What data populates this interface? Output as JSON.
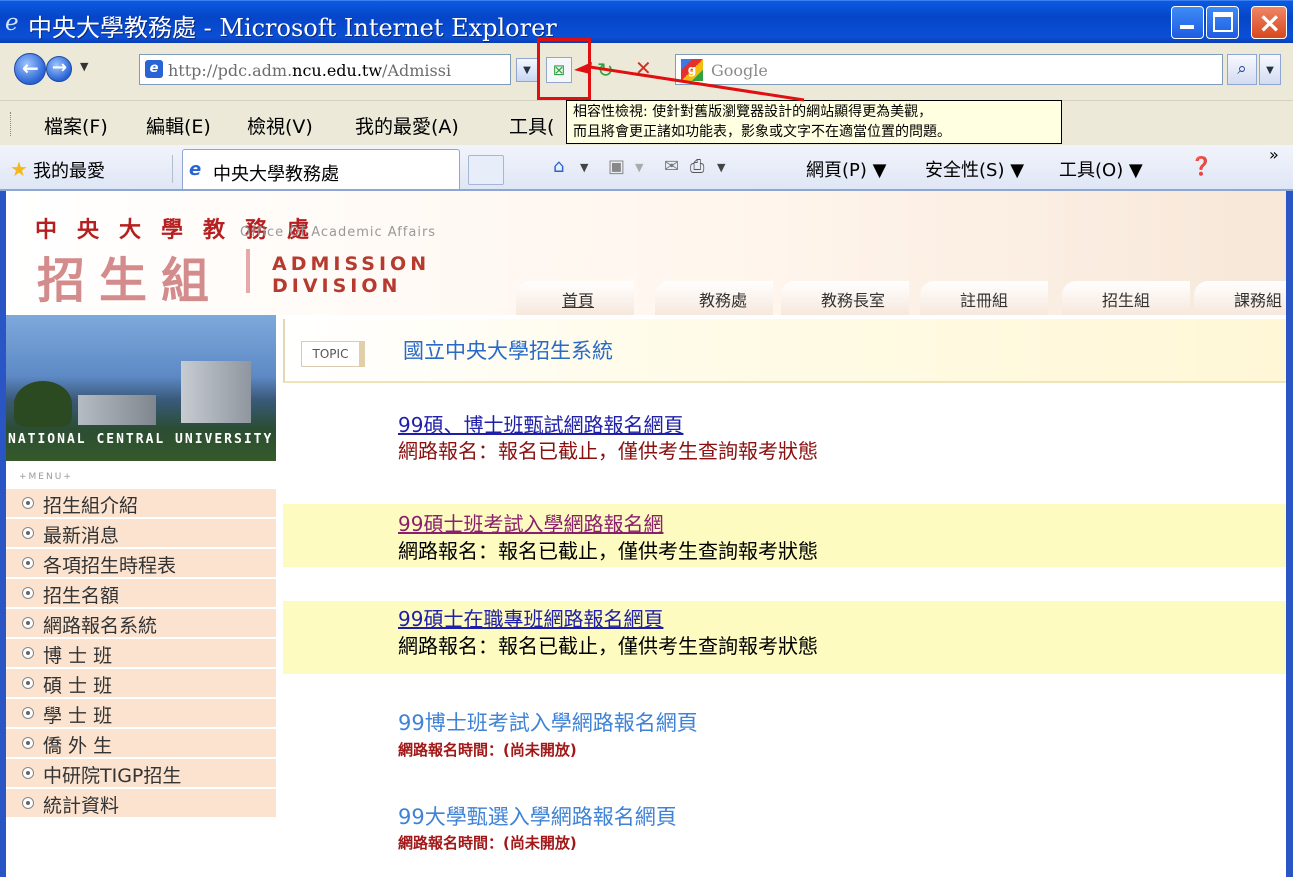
{
  "window": {
    "title": "中央大學教務處 - Microsoft Internet Explorer",
    "ie_icon": "ie-logo-icon",
    "controls": [
      "minimize-icon",
      "maximize-icon",
      "close-icon"
    ]
  },
  "addressbar": {
    "url_prefix": "http://pdc.adm.",
    "url_domain": "ncu.edu.tw",
    "url_suffix": "/Admissi",
    "search_placeholder": "Google",
    "compat_glyph": "⊠",
    "refresh_glyph": "↻",
    "stop_glyph": "✕"
  },
  "menubar": {
    "items": [
      "檔案(F)",
      "編輯(E)",
      "檢視(V)",
      "我的最愛(A)",
      "工具("
    ]
  },
  "tooltip": {
    "line1": "相容性檢視: 使針對舊版瀏覽器設計的網站顯得更為美觀，",
    "line2": "而且將會更正諸如功能表，影象或文字不在適當位置的問題。"
  },
  "tabbar": {
    "favorites_label": "我的最愛",
    "tab_label": "中央大學教務處",
    "commands": {
      "page": "網頁(P) ▼",
      "safety": "安全性(S) ▼",
      "tools": "工具(O) ▼",
      "overflow": "»"
    }
  },
  "header": {
    "office_cn": "中央大學教務處",
    "office_en": "Office Of Academic Affairs",
    "division_cn": "招生組",
    "division_en_1": "ADMISSION",
    "division_en_2": "DIVISION",
    "nav_tabs": [
      "首頁",
      "教務處",
      "教務長室",
      "註冊組",
      "招生組",
      "課務組"
    ]
  },
  "sidebar": {
    "photo_caption": "NATIONAL CENTRAL UNIVERSITY",
    "menu_label": "+MENU+",
    "items": [
      "招生組介紹",
      "最新消息",
      "各項招生時程表",
      "招生名額",
      "網路報名系統",
      "博 士 班",
      "碩 士 班",
      "學 士 班",
      "僑 外 生",
      "中研院TIGP招生",
      "統計資料"
    ]
  },
  "main": {
    "topic_tag": "TOPIC",
    "topic_title": "國立中央大學招生系統",
    "entries": [
      {
        "link": "99碩、博士班甄試網路報名網頁",
        "note": "網路報名：報名已截止，僅供考生查詢報考狀態"
      },
      {
        "link": "99碩士班考試入學網路報名網",
        "note": "網路報名：報名已截止，僅供考生查詢報考狀態"
      },
      {
        "link": "99碩士在職專班網路報名網頁",
        "note": "網路報名：報名已截止，僅供考生查詢報考狀態"
      },
      {
        "link": "99博士班考試入學網路報名網頁",
        "note": "網路報名時間：(尚未開放)"
      },
      {
        "link": "99大學甄選入學網路報名網頁",
        "note": "網路報名時間：(尚未開放)"
      }
    ]
  },
  "colors": {
    "titlebar": "#0645c8",
    "link_red": "#8b1010",
    "link_blue": "#1e1ea8",
    "link_purple": "#8a1f6e",
    "note_red": "#8b1010",
    "highlight_row": "#fdfbc0",
    "sidebar_item": "#fbe3cf"
  }
}
